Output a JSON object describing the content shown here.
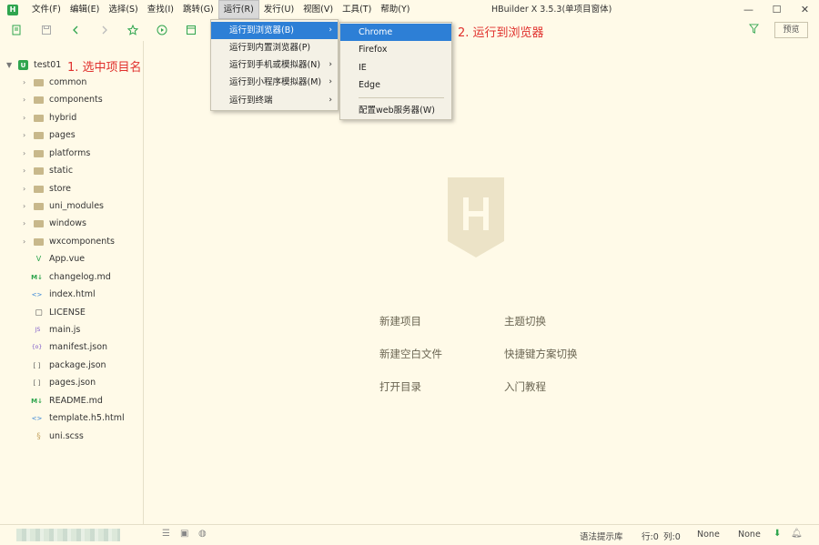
{
  "titlebar": {
    "app_logo": "H",
    "window_title": "HBuilder X 3.5.3(单项目窗体)",
    "menu": [
      "文件(F)",
      "编辑(E)",
      "选择(S)",
      "查找(I)",
      "跳转(G)",
      "运行(R)",
      "发行(U)",
      "视图(V)",
      "工具(T)",
      "帮助(Y)"
    ],
    "controls": [
      "minimize-icon",
      "maximize-icon",
      "close-icon"
    ]
  },
  "toolbar": {
    "icons": [
      "new-file-icon",
      "save-icon",
      "back-icon",
      "forward-icon",
      "favorite-icon",
      "run-icon",
      "browser-preview-icon"
    ],
    "filter_icon": "filter-icon",
    "preview_label": "预览"
  },
  "sidebar": {
    "project": {
      "name": "test01",
      "icon": "U"
    },
    "folders": [
      "common",
      "components",
      "hybrid",
      "pages",
      "platforms",
      "static",
      "store",
      "uni_modules",
      "windows",
      "wxcomponents"
    ],
    "files": [
      {
        "name": "App.vue",
        "icon": "V"
      },
      {
        "name": "changelog.md",
        "icon": "M↓"
      },
      {
        "name": "index.html",
        "icon": "<>"
      },
      {
        "name": "LICENSE",
        "icon": "▢"
      },
      {
        "name": "main.js",
        "icon": "JS"
      },
      {
        "name": "manifest.json",
        "icon": "{o}"
      },
      {
        "name": "package.json",
        "icon": "[ ]"
      },
      {
        "name": "pages.json",
        "icon": "[ ]"
      },
      {
        "name": "README.md",
        "icon": "M↓"
      },
      {
        "name": "template.h5.html",
        "icon": "<>"
      },
      {
        "name": "uni.scss",
        "icon": "§"
      }
    ]
  },
  "annotations": {
    "step1": "1. 选中项目名",
    "step2": "2. 运行到浏览器"
  },
  "run_menu": {
    "items": [
      "运行到浏览器(B)",
      "运行到内置浏览器(P)",
      "运行到手机或模拟器(N)",
      "运行到小程序模拟器(M)",
      "运行到终端"
    ]
  },
  "browser_submenu": {
    "items": [
      "Chrome",
      "Firefox",
      "IE",
      "Edge"
    ],
    "config": "配置web服务器(W)"
  },
  "welcome": {
    "logo": "H",
    "links": [
      "新建项目",
      "主题切换",
      "新建空白文件",
      "快捷键方案切换",
      "打开目录",
      "入门教程"
    ]
  },
  "statusbar": {
    "syntax": "语法提示库",
    "row": "行:0",
    "col": "列:0",
    "encoding": "None",
    "lang": "None"
  }
}
